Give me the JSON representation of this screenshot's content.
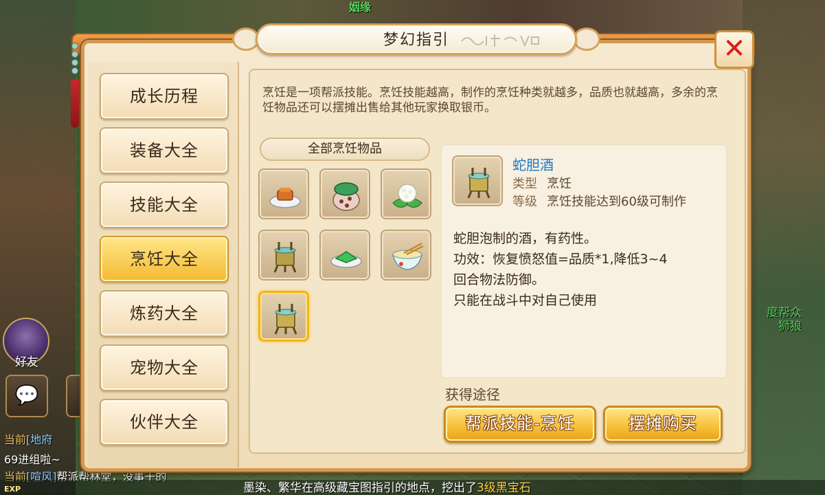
{
  "scene": {
    "npc_name": "姻缘",
    "side_name": "度帮众\n狮狼",
    "friend_label": "好友",
    "exp_label": "EXP",
    "chat": [
      {
        "channel": "当前",
        "bracket": "[地府",
        "text": ""
      },
      {
        "channel": "",
        "bracket": "",
        "text": "69进组啦~"
      },
      {
        "channel": "当前",
        "bracket": "[喧风]",
        "text": "帮派帮林堂，没事干的"
      }
    ],
    "ticker_prefix": "墨染、繁华在高级藏宝图指引的地点，挖出了",
    "ticker_highlight": "3级黑宝石"
  },
  "dialog": {
    "title": "梦幻指引",
    "title_calligraphy": "青青稀诗遍",
    "close_icon": "close-icon"
  },
  "tabs": [
    {
      "label": "成长历程",
      "active": false
    },
    {
      "label": "装备大全",
      "active": false
    },
    {
      "label": "技能大全",
      "active": false
    },
    {
      "label": "烹饪大全",
      "active": true
    },
    {
      "label": "炼药大全",
      "active": false
    },
    {
      "label": "宠物大全",
      "active": false
    },
    {
      "label": "伙伴大全",
      "active": false
    }
  ],
  "content": {
    "description": "烹饪是一项帮派技能。烹饪技能越高，制作的烹饪种类就越多，品质也就越高，多余的烹饪物品还可以摆摊出售给其他玩家换取银币。",
    "list_header": "全部烹饪物品",
    "items": [
      {
        "icon": "tofu-dish-icon"
      },
      {
        "icon": "sealed-jar-icon"
      },
      {
        "icon": "flower-dumpling-icon"
      },
      {
        "icon": "bronze-wine-vessel-icon"
      },
      {
        "icon": "green-cake-icon"
      },
      {
        "icon": "noodle-bowl-icon"
      },
      {
        "icon": "snake-gall-wine-icon",
        "selected": true
      }
    ],
    "detail": {
      "name": "蛇胆酒",
      "type_label": "类型",
      "type_value": "烹饪",
      "level_label": "等级",
      "level_value": "烹饪技能达到60级可制作",
      "effect_lines": [
        "蛇胆泡制的酒，有药性。",
        "功效：恢复愤怒值=品质*1,降低3~4",
        "回合物法防御。",
        "只能在战斗中对自己使用"
      ]
    },
    "source_label": "获得途径",
    "buttons": {
      "guild_skill": "帮派技能-烹饪",
      "stall_buy": "摆摊购买"
    }
  },
  "colors": {
    "accent_gold": "#f7c23c",
    "item_name_blue": "#1a78c8",
    "close_red": "#d81e1e",
    "frame_orange": "#d39a52"
  }
}
